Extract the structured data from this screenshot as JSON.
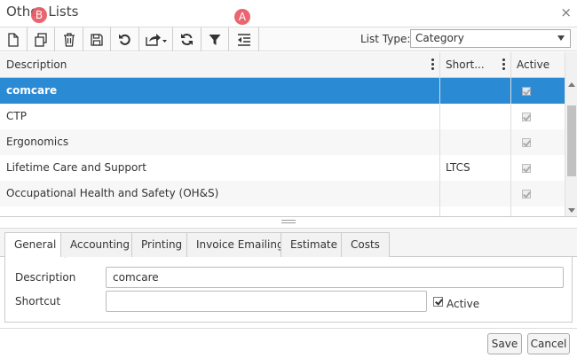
{
  "window": {
    "title": "Other Lists",
    "close_glyph": "×"
  },
  "toolbar": {
    "buttons": [
      {
        "name": "new-icon"
      },
      {
        "name": "copy-icon"
      },
      {
        "name": "delete-icon"
      },
      {
        "name": "save-icon"
      },
      {
        "name": "undo-icon"
      },
      {
        "name": "export-icon"
      },
      {
        "name": "refresh-icon"
      },
      {
        "name": "filter-icon"
      },
      {
        "name": "outdent-icon"
      }
    ],
    "badges": {
      "a": "A",
      "b": "B"
    },
    "list_type_label": "List Type:",
    "list_type_value": "Category"
  },
  "grid": {
    "columns": [
      "Description",
      "Short...",
      "Active"
    ],
    "rows": [
      {
        "description": "comcare",
        "shortcut": "",
        "active": true
      },
      {
        "description": "CTP",
        "shortcut": "",
        "active": true
      },
      {
        "description": "Ergonomics",
        "shortcut": "",
        "active": true
      },
      {
        "description": "Lifetime Care and Support",
        "shortcut": "LTCS",
        "active": true
      },
      {
        "description": "Occupational Health and Safety (OH&S)",
        "shortcut": "",
        "active": true
      }
    ],
    "selected_row": 0
  },
  "tabs": [
    "General",
    "Accounting",
    "Printing",
    "Invoice Emailing",
    "Estimate",
    "Costs"
  ],
  "active_tab": 0,
  "form": {
    "description_label": "Description",
    "description_value": "comcare",
    "shortcut_label": "Shortcut",
    "shortcut_value": "",
    "active_label": "Active",
    "active_checked": true
  },
  "footer": {
    "save_label": "Save",
    "cancel_label": "Cancel"
  },
  "colors": {
    "selection": "#2a8ad4",
    "badge": "#e85a66"
  }
}
